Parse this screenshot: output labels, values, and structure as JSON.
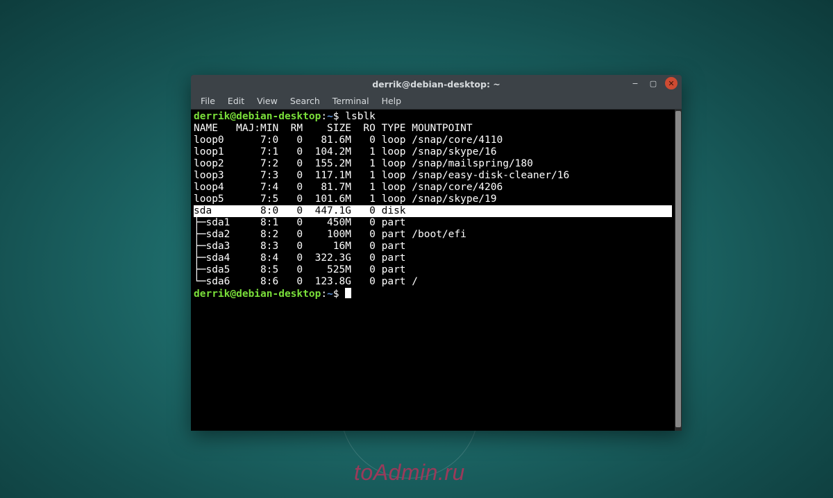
{
  "watermark": "toAdmin.ru",
  "window": {
    "title": "derrik@debian-desktop: ~",
    "controls": {
      "min": "−",
      "max": "▢",
      "close": "✕"
    }
  },
  "menubar": [
    "File",
    "Edit",
    "View",
    "Search",
    "Terminal",
    "Help"
  ],
  "prompt": {
    "user_host": "derrik@debian-desktop",
    "sep": ":",
    "path": "~",
    "symbol": "$"
  },
  "command": "lsblk",
  "header": {
    "name": "NAME",
    "majmin": "MAJ:MIN",
    "rm": "RM",
    "size": "SIZE",
    "ro": "RO",
    "type": "TYPE",
    "mount": "MOUNTPOINT"
  },
  "rows": [
    {
      "name": "loop0",
      "majmin": "7:0",
      "rm": "0",
      "size": "81.6M",
      "ro": "0",
      "type": "loop",
      "mount": "/snap/core/4110",
      "tree": "",
      "hl": false
    },
    {
      "name": "loop1",
      "majmin": "7:1",
      "rm": "0",
      "size": "104.2M",
      "ro": "1",
      "type": "loop",
      "mount": "/snap/skype/16",
      "tree": "",
      "hl": false
    },
    {
      "name": "loop2",
      "majmin": "7:2",
      "rm": "0",
      "size": "155.2M",
      "ro": "1",
      "type": "loop",
      "mount": "/snap/mailspring/180",
      "tree": "",
      "hl": false
    },
    {
      "name": "loop3",
      "majmin": "7:3",
      "rm": "0",
      "size": "117.1M",
      "ro": "1",
      "type": "loop",
      "mount": "/snap/easy-disk-cleaner/16",
      "tree": "",
      "hl": false
    },
    {
      "name": "loop4",
      "majmin": "7:4",
      "rm": "0",
      "size": "81.7M",
      "ro": "1",
      "type": "loop",
      "mount": "/snap/core/4206",
      "tree": "",
      "hl": false
    },
    {
      "name": "loop5",
      "majmin": "7:5",
      "rm": "0",
      "size": "101.6M",
      "ro": "1",
      "type": "loop",
      "mount": "/snap/skype/19",
      "tree": "",
      "hl": false
    },
    {
      "name": "sda",
      "majmin": "8:0",
      "rm": "0",
      "size": "447.1G",
      "ro": "0",
      "type": "disk",
      "mount": "",
      "tree": "",
      "hl": true
    },
    {
      "name": "sda1",
      "majmin": "8:1",
      "rm": "0",
      "size": "450M",
      "ro": "0",
      "type": "part",
      "mount": "",
      "tree": "├─",
      "hl": false
    },
    {
      "name": "sda2",
      "majmin": "8:2",
      "rm": "0",
      "size": "100M",
      "ro": "0",
      "type": "part",
      "mount": "/boot/efi",
      "tree": "├─",
      "hl": false
    },
    {
      "name": "sda3",
      "majmin": "8:3",
      "rm": "0",
      "size": "16M",
      "ro": "0",
      "type": "part",
      "mount": "",
      "tree": "├─",
      "hl": false
    },
    {
      "name": "sda4",
      "majmin": "8:4",
      "rm": "0",
      "size": "322.3G",
      "ro": "0",
      "type": "part",
      "mount": "",
      "tree": "├─",
      "hl": false
    },
    {
      "name": "sda5",
      "majmin": "8:5",
      "rm": "0",
      "size": "525M",
      "ro": "0",
      "type": "part",
      "mount": "",
      "tree": "├─",
      "hl": false
    },
    {
      "name": "sda6",
      "majmin": "8:6",
      "rm": "0",
      "size": "123.8G",
      "ro": "0",
      "type": "part",
      "mount": "/",
      "tree": "└─",
      "hl": false
    }
  ],
  "cols": {
    "name": 6,
    "majmin": 7,
    "rm": 3,
    "size": 7,
    "ro": 3,
    "type": 5
  }
}
